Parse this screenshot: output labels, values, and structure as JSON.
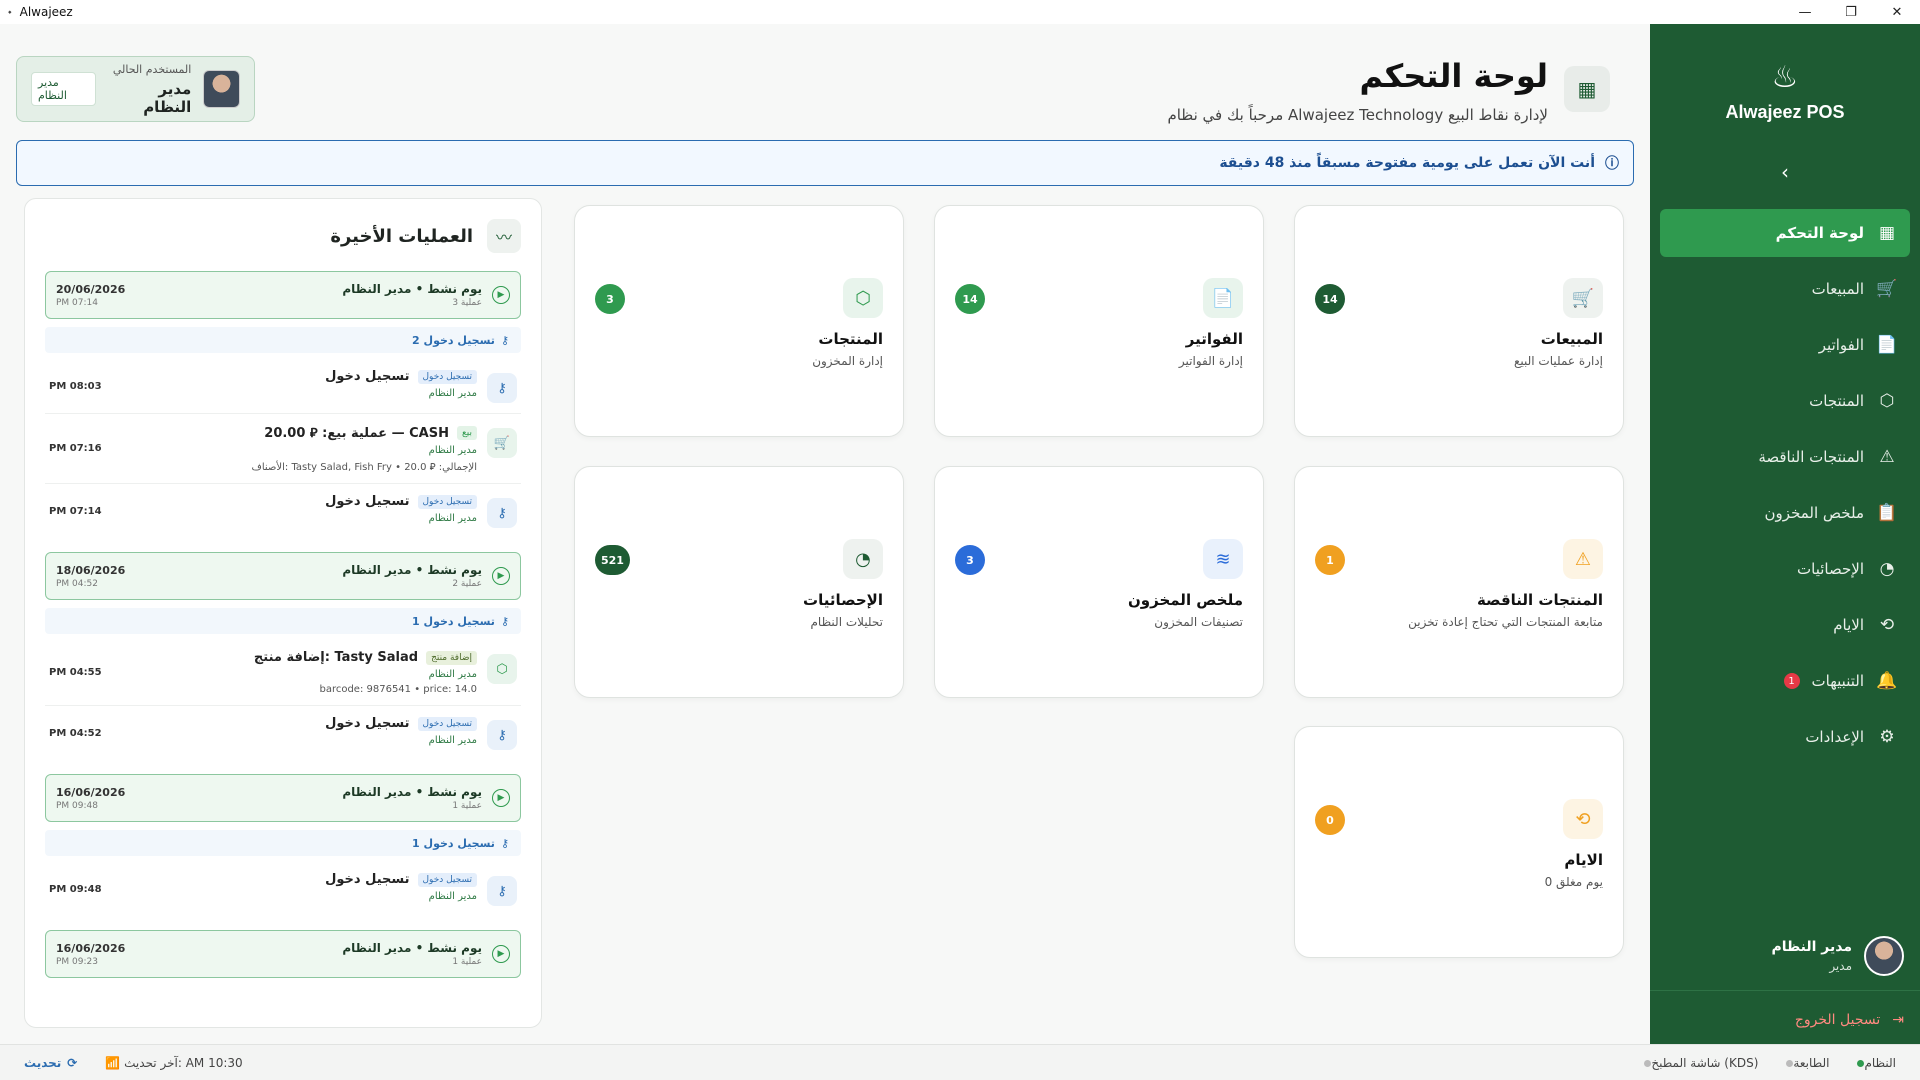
{
  "window": {
    "title": "Alwajeez",
    "minimize": "—",
    "restore": "❐",
    "close": "✕"
  },
  "sidebar": {
    "brand": "Alwajeez POS",
    "collapse_icon": "‹",
    "items": [
      {
        "label": "لوحة التحكم",
        "icon": "▦",
        "active": true
      },
      {
        "label": "المبيعات",
        "icon": "🛒"
      },
      {
        "label": "الفواتير",
        "icon": "📄"
      },
      {
        "label": "المنتجات",
        "icon": "⬡"
      },
      {
        "label": "المنتجات الناقصة",
        "icon": "⚠"
      },
      {
        "label": "ملخص المخزون",
        "icon": "📋"
      },
      {
        "label": "الإحصائيات",
        "icon": "◔"
      },
      {
        "label": "الايام",
        "icon": "⟲"
      },
      {
        "label": "التنبيهات",
        "icon": "🔔",
        "badge": "1"
      },
      {
        "label": "الإعدادات",
        "icon": "⚙"
      }
    ],
    "user": {
      "name": "مدير النظام",
      "role": "مدير"
    },
    "logout": "تسجيل الخروج"
  },
  "header": {
    "title": "لوحة التحكم",
    "subtitle": "مرحباً بك في نظام Alwajeez Technology لإدارة نقاط البيع"
  },
  "user_card": {
    "label": "المستخدم الحالي",
    "name": "مدير النظام",
    "role": "مدير النظام"
  },
  "notice": {
    "text": "أنت الآن تعمل على يومية مفتوحة مسبقاً منذ 48 دقيقة"
  },
  "activity": {
    "title": "العمليات الأخيرة",
    "days": [
      {
        "title": "يوم نشط • مدير النظام",
        "count": "3 عملية",
        "date": "20/06/2026",
        "time": "PM 07:14",
        "logins": "2 تسجيل دخول",
        "ops": [
          {
            "tag": "تسجيل دخول",
            "tag_style": "blue",
            "name": "تسجيل دخول",
            "user": "مدير النظام",
            "detail": "",
            "time": "PM 08:03",
            "icon": "⚷",
            "icon_style": "blue"
          },
          {
            "tag": "بيع",
            "tag_style": "green",
            "name": "عملية بيع: ⃁ 20.00 — CASH",
            "user": "مدير النظام",
            "detail": "الأصناف: Tasty Salad, Fish Fry • الإجمالي: ⃁ 20.0",
            "time": "PM 07:16",
            "icon": "🛒",
            "icon_style": "green"
          },
          {
            "tag": "تسجيل دخول",
            "tag_style": "blue",
            "name": "تسجيل دخول",
            "user": "مدير النظام",
            "detail": "",
            "time": "PM 07:14",
            "icon": "⚷",
            "icon_style": "blue"
          }
        ]
      },
      {
        "title": "يوم نشط • مدير النظام",
        "count": "2 عملية",
        "date": "18/06/2026",
        "time": "PM 04:52",
        "logins": "1 تسجيل دخول",
        "ops": [
          {
            "tag": "إضافة منتج",
            "tag_style": "olive",
            "name": "إضافة منتج: Tasty Salad",
            "user": "مدير النظام",
            "detail": "barcode: 9876541 • price: 14.0",
            "time": "PM 04:55",
            "icon": "⬡",
            "icon_style": "green"
          },
          {
            "tag": "تسجيل دخول",
            "tag_style": "blue",
            "name": "تسجيل دخول",
            "user": "مدير النظام",
            "detail": "",
            "time": "PM 04:52",
            "icon": "⚷",
            "icon_style": "blue"
          }
        ]
      },
      {
        "title": "يوم نشط • مدير النظام",
        "count": "1 عملية",
        "date": "16/06/2026",
        "time": "PM 09:48",
        "logins": "1 تسجيل دخول",
        "ops": [
          {
            "tag": "تسجيل دخول",
            "tag_style": "blue",
            "name": "تسجيل دخول",
            "user": "مدير النظام",
            "detail": "",
            "time": "PM 09:48",
            "icon": "⚷",
            "icon_style": "blue"
          }
        ]
      },
      {
        "title": "يوم نشط • مدير النظام",
        "count": "1 عملية",
        "date": "16/06/2026",
        "time": "PM 09:23",
        "logins": "",
        "ops": []
      }
    ]
  },
  "cards": [
    {
      "id": "sales",
      "title": "المبيعات",
      "subtitle": "إدارة عمليات البيع",
      "count": "14",
      "icon": "🛒",
      "color": "#1e5b33",
      "icon_bg": "#eef2ef",
      "icon_color": "#1e5b33"
    },
    {
      "id": "invoices",
      "title": "الفواتير",
      "subtitle": "إدارة الفواتير",
      "count": "14",
      "icon": "📄",
      "color": "#2f9a4f",
      "icon_bg": "#e8f4ec",
      "icon_color": "#2f9a4f"
    },
    {
      "id": "products",
      "title": "المنتجات",
      "subtitle": "إدارة المخزون",
      "count": "3",
      "icon": "⬡",
      "color": "#2f9a4f",
      "icon_bg": "#e8f4ec",
      "icon_color": "#2f9a4f"
    },
    {
      "id": "low-stock",
      "title": "المنتجات الناقصة",
      "subtitle": "متابعة المنتجات التي تحتاج إعادة تخزين",
      "count": "1",
      "icon": "⚠",
      "color": "#f0a020",
      "icon_bg": "#fdf4e3",
      "icon_color": "#f0a020"
    },
    {
      "id": "inventory",
      "title": "ملخص المخزون",
      "subtitle": "تصنيفات المخزون",
      "count": "3",
      "icon": "≋",
      "color": "#2b6cd9",
      "icon_bg": "#e9f1fc",
      "icon_color": "#2b6cd9"
    },
    {
      "id": "stats",
      "title": "الإحصائيات",
      "subtitle": "تحليلات النظام",
      "count": "521",
      "icon": "◔",
      "color": "#1e5b33",
      "icon_bg": "#eef2ef",
      "icon_color": "#1e5b33"
    },
    {
      "id": "days",
      "title": "الايام",
      "subtitle": "0 يوم مغلق",
      "count": "0",
      "icon": "⟲",
      "color": "#f0a020",
      "icon_bg": "#fdf4e3",
      "icon_color": "#f0a020"
    }
  ],
  "statusbar": {
    "refresh": "تحديث",
    "last_update": "آخر تحديث: AM 10:30",
    "indicators": [
      {
        "label": "النظام",
        "color": "#2f9a4f"
      },
      {
        "label": "الطابعة",
        "color": "#bbbbbb"
      },
      {
        "label": "شاشة المطبخ (KDS)",
        "color": "#bbbbbb"
      }
    ]
  }
}
